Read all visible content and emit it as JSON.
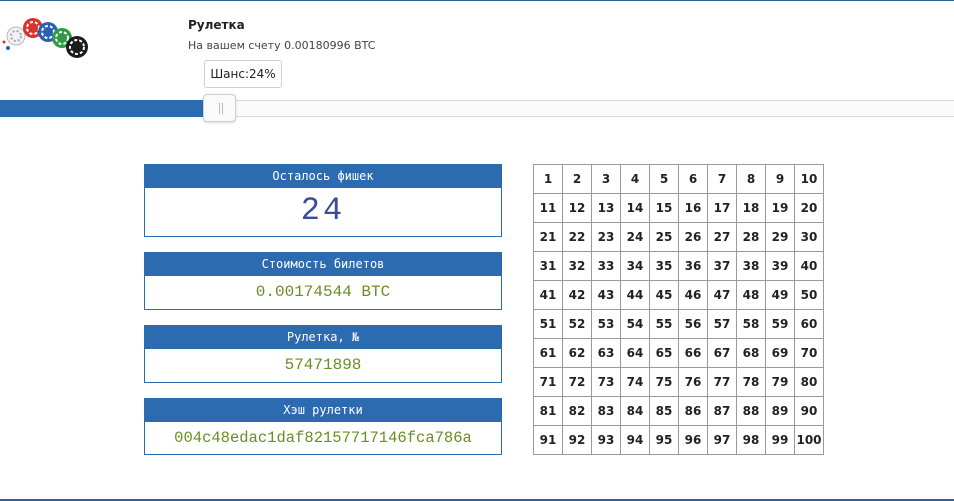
{
  "header": {
    "title": "Рулетка",
    "balance": "На вашем счету 0.00180996 BTC"
  },
  "slider": {
    "tooltip": "Шанс:24%",
    "value_percent": 24
  },
  "panels": {
    "chips": {
      "label": "Осталось фишек",
      "value": "24"
    },
    "ticket_cost": {
      "label": "Стоимость билетов",
      "value": "0.00174544 BTC"
    },
    "roulette_number": {
      "label": "Рулетка, №",
      "value": "57471898"
    },
    "roulette_hash": {
      "label": "Хэш рулетки",
      "value": "004c48edac1daf82157717146fca786a"
    }
  },
  "grid": {
    "numbers": [
      "1",
      "2",
      "3",
      "4",
      "5",
      "6",
      "7",
      "8",
      "9",
      "10",
      "11",
      "12",
      "13",
      "14",
      "15",
      "16",
      "17",
      "18",
      "19",
      "20",
      "21",
      "22",
      "23",
      "24",
      "25",
      "26",
      "27",
      "28",
      "29",
      "30",
      "31",
      "32",
      "33",
      "34",
      "35",
      "36",
      "37",
      "38",
      "39",
      "40",
      "41",
      "42",
      "43",
      "44",
      "45",
      "46",
      "47",
      "48",
      "49",
      "50",
      "51",
      "52",
      "53",
      "54",
      "55",
      "56",
      "57",
      "58",
      "59",
      "60",
      "61",
      "62",
      "63",
      "64",
      "65",
      "66",
      "67",
      "68",
      "69",
      "70",
      "71",
      "72",
      "73",
      "74",
      "75",
      "76",
      "77",
      "78",
      "79",
      "80",
      "81",
      "82",
      "83",
      "84",
      "85",
      "86",
      "87",
      "88",
      "89",
      "90",
      "91",
      "92",
      "93",
      "94",
      "95",
      "96",
      "97",
      "98",
      "99",
      "100"
    ]
  },
  "colors": {
    "accent": "#2d6bb0",
    "value_green": "#6b8e23",
    "value_blue": "#3b4a9b"
  },
  "icons": {
    "logo": "casino-chips-logo"
  }
}
